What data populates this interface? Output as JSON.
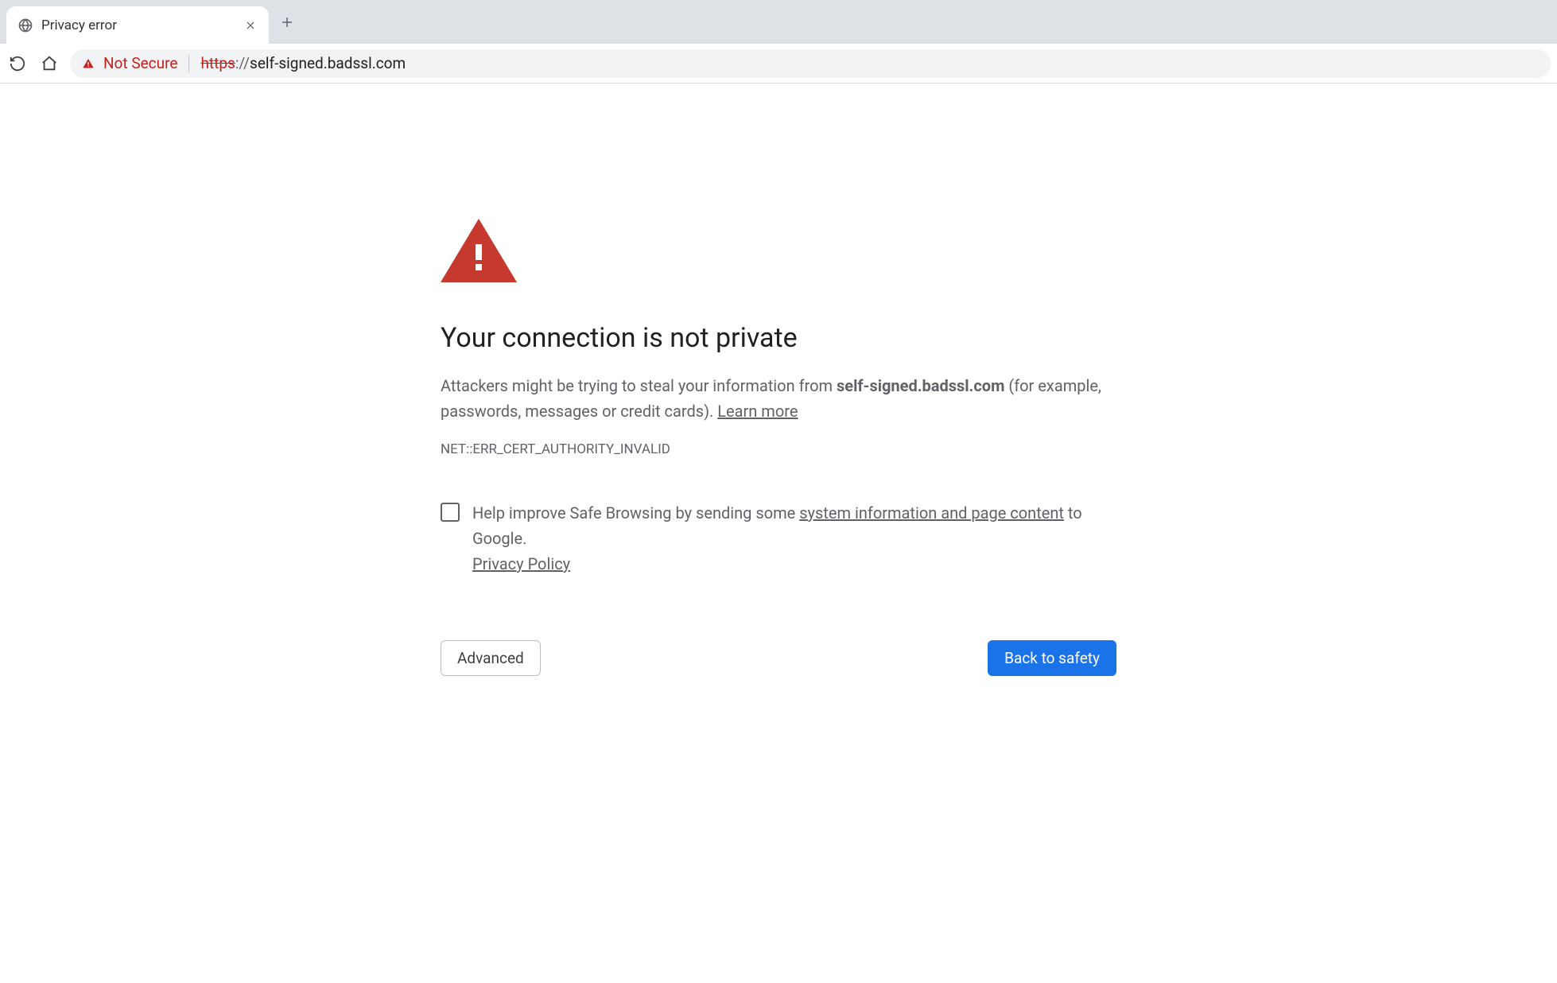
{
  "tab": {
    "title": "Privacy error"
  },
  "omnibox": {
    "not_secure_label": "Not Secure",
    "url_scheme": "https",
    "url_delim": "://",
    "url_host": "self-signed.badssl.com"
  },
  "interstitial": {
    "heading": "Your connection is not private",
    "body_prefix": "Attackers might be trying to steal your information from ",
    "body_host": "self-signed.badssl.com",
    "body_suffix": " (for example, passwords, messages or credit cards). ",
    "learn_more": "Learn more",
    "error_code": "NET::ERR_CERT_AUTHORITY_INVALID",
    "optin_prefix": "Help improve Safe Browsing by sending some ",
    "optin_link": "system information and page content",
    "optin_suffix": " to Google. ",
    "privacy_policy": "Privacy Policy",
    "advanced_label": "Advanced",
    "back_label": "Back to safety"
  },
  "colors": {
    "danger": "#c5221f",
    "primary": "#1a73e8",
    "muted": "#5f6368"
  }
}
